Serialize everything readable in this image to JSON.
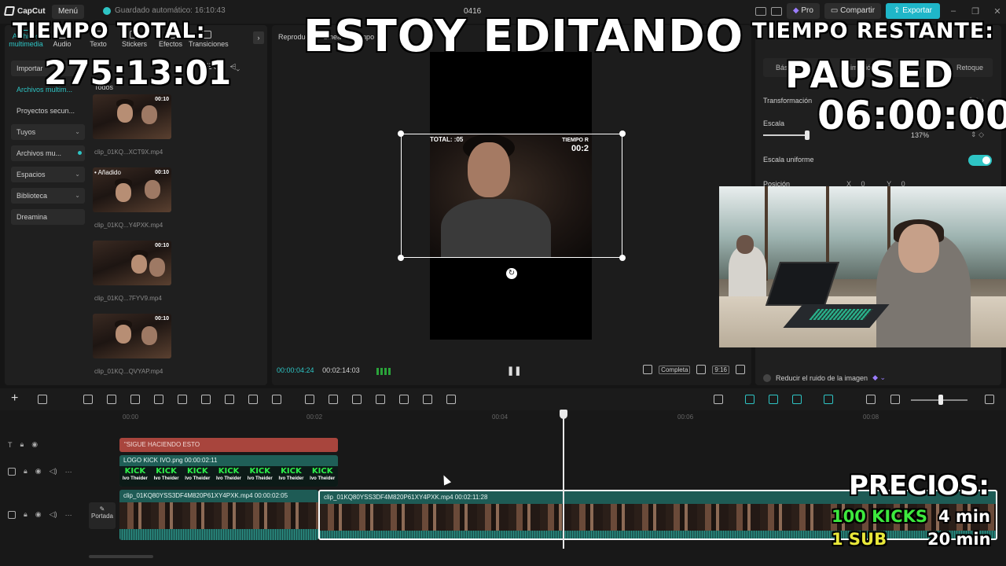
{
  "app": {
    "logo": "CapCut",
    "menu_label": "Menú",
    "autosave": "Guardado automático: 16:10:43",
    "project_name": "0416",
    "pro_label": "Pro",
    "share_label": "Compartir",
    "export_label": "Exportar"
  },
  "media_panel": {
    "tabs": [
      "Archivos multimedia",
      "Audio",
      "Texto",
      "Stickers",
      "Efectos",
      "Transiciones"
    ],
    "nav": [
      {
        "label": "Importar"
      },
      {
        "label": "Archivos multim..."
      },
      {
        "label": "Proyectos secun..."
      },
      {
        "label": "Tuyos"
      },
      {
        "label": "Archivos mu..."
      },
      {
        "label": "Espacios"
      },
      {
        "label": "Biblioteca"
      },
      {
        "label": "Dreamina"
      }
    ],
    "all_label": "Todos",
    "added_label": "Añadido",
    "clips": [
      {
        "name": "clip_01KQ...XCT9X.mp4",
        "duration": "00:10"
      },
      {
        "name": "clip_01KQ...Y4PXK.mp4",
        "duration": "00:10"
      },
      {
        "name": "clip_01KQ...7FYV9.mp4",
        "duration": "00:10"
      },
      {
        "name": "clip_01KQ...QVYAP.mp4",
        "duration": "00:10"
      }
    ]
  },
  "preview": {
    "title": "Reproductor - Línea de tiempo",
    "current_time": "00:00:04:24",
    "total_time": "00:02:14:03",
    "full_label": "Completa",
    "ratio_label": "9:16",
    "overlay_left": "TOTAL: :05",
    "overlay_right_top": "TIEMPO R",
    "overlay_right_val": "00:2"
  },
  "inspector": {
    "tabs": [
      "Básico",
      "Animación",
      "Retoque"
    ],
    "transform_label": "Transformación",
    "scale_label": "Escala",
    "scale_value": "137%",
    "scale_fraction": 0.37,
    "uniform_label": "Escala uniforme",
    "uniform_on": true,
    "position_label": "Posición",
    "pos_x_label": "X",
    "pos_x": "0",
    "pos_y_label": "Y",
    "pos_y": "0",
    "noise_label": "Reducir el ruido de la imagen"
  },
  "timeline": {
    "ruler": [
      "00:00",
      "00:02",
      "00:04",
      "00:06",
      "00:08"
    ],
    "text_clip": "\"SIGUE HACIENDO ESTO",
    "logo_clip": "LOGO KICK IVO.png  00:00:02:11",
    "kick_word": "KICK",
    "kick_sub": "Ivo Theider",
    "video_clip_1": "clip_01KQ80YSS3DF4M820P61XY4PXK.mp4  00:00:02:05",
    "video_clip_2": "clip_01KQ80YSS3DF4M820P61XY4PXK.mp4  00:02:11:28",
    "cover_label": "Portada"
  },
  "overlay": {
    "total_label": "TIEMPO TOTAL:",
    "total_value": "275:13:01",
    "headline": "ESTOY EDITANDO",
    "remaining_label": "TIEMPO RESTANTE:",
    "status": "PAUSED",
    "remaining_value": "06:00:00",
    "prices_label": "PRECIOS:",
    "price_1_item": "100 KICKS",
    "price_1_time": "4 min",
    "price_2_item": "1 SUB",
    "price_2_time": "20 min"
  },
  "colors": {
    "accent": "#2ec4c4",
    "export": "#1fb6c9",
    "text_clip": "#a8453d",
    "video_clip": "#1e5b55",
    "kick_green": "#2df04a",
    "price_green": "#3de83d",
    "price_yellow": "#e8e83a"
  }
}
